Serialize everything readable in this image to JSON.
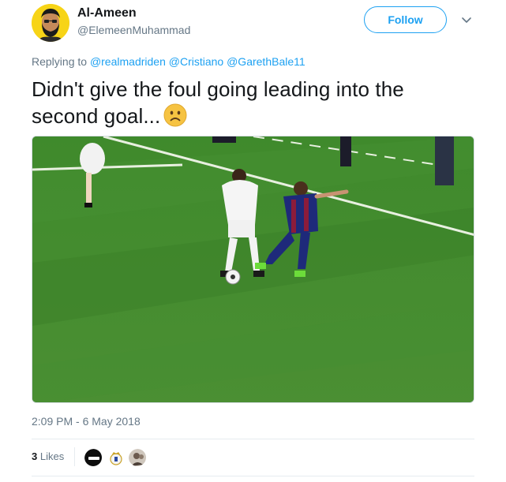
{
  "author": {
    "name": "Al-Ameen",
    "handle": "@ElemeenMuhammad"
  },
  "follow_button": {
    "label": "Follow"
  },
  "menu": {
    "icon": "chevron-down-icon"
  },
  "reply": {
    "prefix": "Replying to",
    "mentions": [
      "@realmadriden",
      "@Cristiano",
      "@GarethBale11"
    ]
  },
  "tweet": {
    "text_line1": "Didn't give the foul going leading into the",
    "text_line2": "second goal...",
    "emoji": "slightly-frowning-face-emoji"
  },
  "media": {
    "description_icon": "football-match-image"
  },
  "timestamp": "2:09 PM - 6 May 2018",
  "stats": {
    "likes_count": "3",
    "likes_label": "Likes"
  },
  "colors": {
    "accent": "#1da1f2",
    "secondary_text": "#657786",
    "avatar_bg": "#f7d417"
  }
}
